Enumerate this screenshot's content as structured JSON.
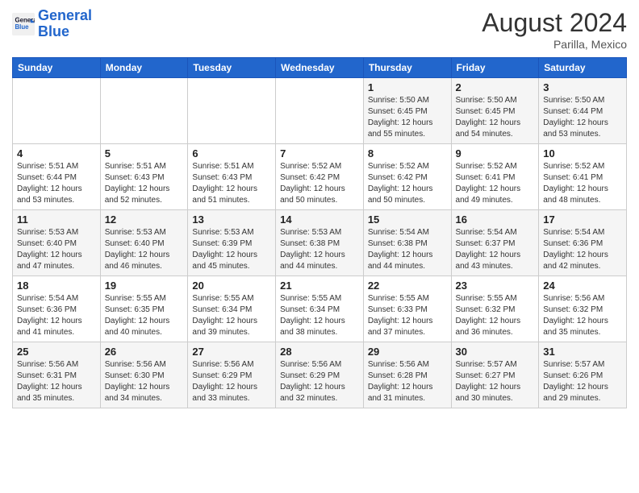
{
  "header": {
    "logo_line1": "General",
    "logo_line2": "Blue",
    "month_year": "August 2024",
    "location": "Parilla, Mexico"
  },
  "days_of_week": [
    "Sunday",
    "Monday",
    "Tuesday",
    "Wednesday",
    "Thursday",
    "Friday",
    "Saturday"
  ],
  "weeks": [
    [
      {
        "day": "",
        "info": ""
      },
      {
        "day": "",
        "info": ""
      },
      {
        "day": "",
        "info": ""
      },
      {
        "day": "",
        "info": ""
      },
      {
        "day": "1",
        "info": "Sunrise: 5:50 AM\nSunset: 6:45 PM\nDaylight: 12 hours\nand 55 minutes."
      },
      {
        "day": "2",
        "info": "Sunrise: 5:50 AM\nSunset: 6:45 PM\nDaylight: 12 hours\nand 54 minutes."
      },
      {
        "day": "3",
        "info": "Sunrise: 5:50 AM\nSunset: 6:44 PM\nDaylight: 12 hours\nand 53 minutes."
      }
    ],
    [
      {
        "day": "4",
        "info": "Sunrise: 5:51 AM\nSunset: 6:44 PM\nDaylight: 12 hours\nand 53 minutes."
      },
      {
        "day": "5",
        "info": "Sunrise: 5:51 AM\nSunset: 6:43 PM\nDaylight: 12 hours\nand 52 minutes."
      },
      {
        "day": "6",
        "info": "Sunrise: 5:51 AM\nSunset: 6:43 PM\nDaylight: 12 hours\nand 51 minutes."
      },
      {
        "day": "7",
        "info": "Sunrise: 5:52 AM\nSunset: 6:42 PM\nDaylight: 12 hours\nand 50 minutes."
      },
      {
        "day": "8",
        "info": "Sunrise: 5:52 AM\nSunset: 6:42 PM\nDaylight: 12 hours\nand 50 minutes."
      },
      {
        "day": "9",
        "info": "Sunrise: 5:52 AM\nSunset: 6:41 PM\nDaylight: 12 hours\nand 49 minutes."
      },
      {
        "day": "10",
        "info": "Sunrise: 5:52 AM\nSunset: 6:41 PM\nDaylight: 12 hours\nand 48 minutes."
      }
    ],
    [
      {
        "day": "11",
        "info": "Sunrise: 5:53 AM\nSunset: 6:40 PM\nDaylight: 12 hours\nand 47 minutes."
      },
      {
        "day": "12",
        "info": "Sunrise: 5:53 AM\nSunset: 6:40 PM\nDaylight: 12 hours\nand 46 minutes."
      },
      {
        "day": "13",
        "info": "Sunrise: 5:53 AM\nSunset: 6:39 PM\nDaylight: 12 hours\nand 45 minutes."
      },
      {
        "day": "14",
        "info": "Sunrise: 5:53 AM\nSunset: 6:38 PM\nDaylight: 12 hours\nand 44 minutes."
      },
      {
        "day": "15",
        "info": "Sunrise: 5:54 AM\nSunset: 6:38 PM\nDaylight: 12 hours\nand 44 minutes."
      },
      {
        "day": "16",
        "info": "Sunrise: 5:54 AM\nSunset: 6:37 PM\nDaylight: 12 hours\nand 43 minutes."
      },
      {
        "day": "17",
        "info": "Sunrise: 5:54 AM\nSunset: 6:36 PM\nDaylight: 12 hours\nand 42 minutes."
      }
    ],
    [
      {
        "day": "18",
        "info": "Sunrise: 5:54 AM\nSunset: 6:36 PM\nDaylight: 12 hours\nand 41 minutes."
      },
      {
        "day": "19",
        "info": "Sunrise: 5:55 AM\nSunset: 6:35 PM\nDaylight: 12 hours\nand 40 minutes."
      },
      {
        "day": "20",
        "info": "Sunrise: 5:55 AM\nSunset: 6:34 PM\nDaylight: 12 hours\nand 39 minutes."
      },
      {
        "day": "21",
        "info": "Sunrise: 5:55 AM\nSunset: 6:34 PM\nDaylight: 12 hours\nand 38 minutes."
      },
      {
        "day": "22",
        "info": "Sunrise: 5:55 AM\nSunset: 6:33 PM\nDaylight: 12 hours\nand 37 minutes."
      },
      {
        "day": "23",
        "info": "Sunrise: 5:55 AM\nSunset: 6:32 PM\nDaylight: 12 hours\nand 36 minutes."
      },
      {
        "day": "24",
        "info": "Sunrise: 5:56 AM\nSunset: 6:32 PM\nDaylight: 12 hours\nand 35 minutes."
      }
    ],
    [
      {
        "day": "25",
        "info": "Sunrise: 5:56 AM\nSunset: 6:31 PM\nDaylight: 12 hours\nand 35 minutes."
      },
      {
        "day": "26",
        "info": "Sunrise: 5:56 AM\nSunset: 6:30 PM\nDaylight: 12 hours\nand 34 minutes."
      },
      {
        "day": "27",
        "info": "Sunrise: 5:56 AM\nSunset: 6:29 PM\nDaylight: 12 hours\nand 33 minutes."
      },
      {
        "day": "28",
        "info": "Sunrise: 5:56 AM\nSunset: 6:29 PM\nDaylight: 12 hours\nand 32 minutes."
      },
      {
        "day": "29",
        "info": "Sunrise: 5:56 AM\nSunset: 6:28 PM\nDaylight: 12 hours\nand 31 minutes."
      },
      {
        "day": "30",
        "info": "Sunrise: 5:57 AM\nSunset: 6:27 PM\nDaylight: 12 hours\nand 30 minutes."
      },
      {
        "day": "31",
        "info": "Sunrise: 5:57 AM\nSunset: 6:26 PM\nDaylight: 12 hours\nand 29 minutes."
      }
    ]
  ]
}
